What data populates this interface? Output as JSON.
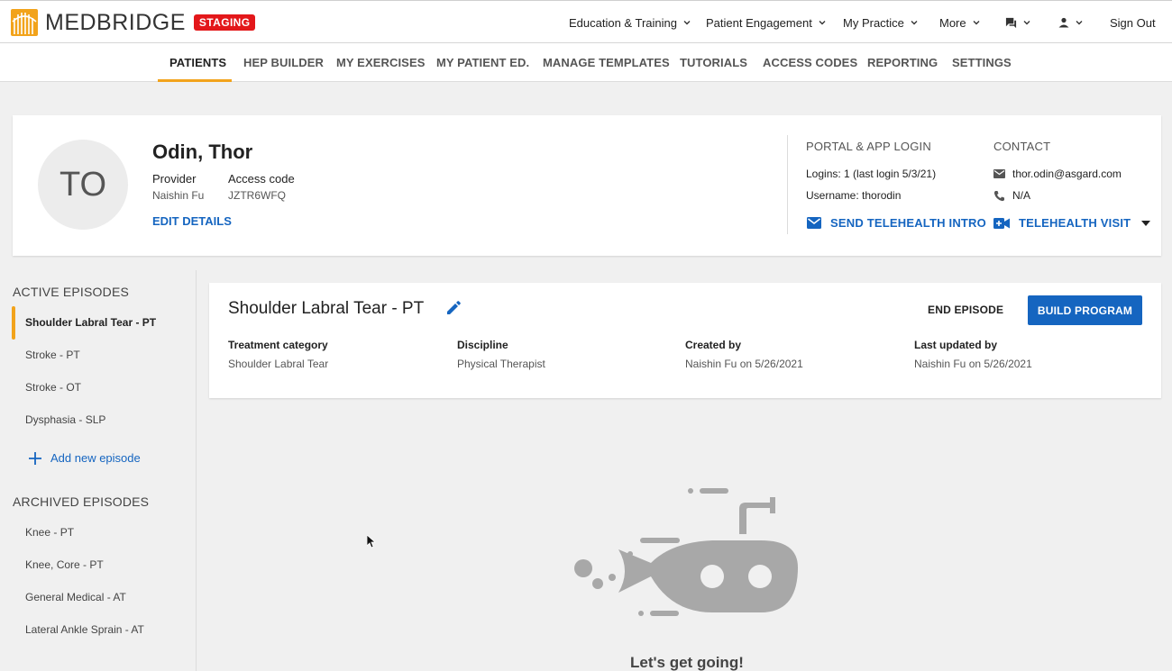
{
  "app": {
    "brand": "MEDBRIDGE",
    "env_badge": "STAGING"
  },
  "topnav": {
    "education": "Education & Training",
    "engagement": "Patient Engagement",
    "practice": "My Practice",
    "more": "More",
    "sign_out": "Sign Out"
  },
  "tabs": {
    "patients": "PATIENTS",
    "hep_builder": "HEP BUILDER",
    "my_exercises": "MY EXERCISES",
    "my_patient_ed": "MY PATIENT ED.",
    "manage_templates": "MANAGE TEMPLATES",
    "tutorials": "TUTORIALS",
    "access_codes": "ACCESS CODES",
    "reporting": "REPORTING",
    "settings": "SETTINGS"
  },
  "patient": {
    "initials": "TO",
    "name": "Odin, Thor",
    "provider_label": "Provider",
    "provider": "Naishin Fu",
    "access_code_label": "Access code",
    "access_code": "JZTR6WFQ",
    "edit_details": "EDIT DETAILS"
  },
  "portal": {
    "heading": "PORTAL & APP LOGIN",
    "logins": "Logins: 1 (last login 5/3/21)",
    "username": "Username: thorodin",
    "send_intro": "SEND TELEHEALTH INTRO"
  },
  "contact": {
    "heading": "CONTACT",
    "email": "thor.odin@asgard.com",
    "phone": "N/A",
    "telehealth_visit": "TELEHEALTH VISIT"
  },
  "sidebar": {
    "active_heading": "ACTIVE EPISODES",
    "active": [
      "Shoulder Labral Tear - PT",
      "Stroke - PT",
      "Stroke - OT",
      "Dysphasia - SLP"
    ],
    "add_episode": "Add new episode",
    "archived_heading": "ARCHIVED EPISODES",
    "archived": [
      "Knee - PT",
      "Knee, Core - PT",
      "General Medical - AT",
      "Lateral Ankle Sprain - AT"
    ]
  },
  "episode": {
    "title": "Shoulder Labral Tear - PT",
    "end_episode": "END EPISODE",
    "build_program": "BUILD PROGRAM",
    "treatment_label": "Treatment category",
    "treatment": "Shoulder Labral Tear",
    "discipline_label": "Discipline",
    "discipline": "Physical Therapist",
    "created_label": "Created by",
    "created": "Naishin Fu on 5/26/2021",
    "updated_label": "Last updated by",
    "updated": "Naishin Fu on 5/26/2021"
  },
  "empty_state": {
    "message": "Let's get going!"
  },
  "colors": {
    "accent": "#f2a31b",
    "link": "#1565c0",
    "badge": "#e3171a",
    "illustration": "#a8a8a8"
  }
}
